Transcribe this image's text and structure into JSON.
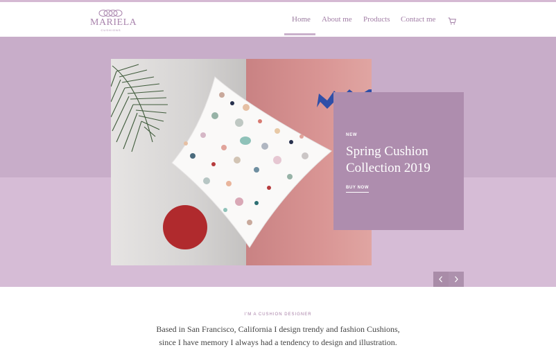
{
  "brand": {
    "name": "MARIELA",
    "tagline": "CUSHIONS",
    "accent": "#a984ad"
  },
  "nav": {
    "items": [
      {
        "label": "Home",
        "active": true
      },
      {
        "label": "About me",
        "active": false
      },
      {
        "label": "Products",
        "active": false
      },
      {
        "label": "Contact me",
        "active": false
      }
    ],
    "cart_icon": "cart-icon"
  },
  "hero": {
    "tag": "NEW",
    "title": "Spring Cushion Collection 2019",
    "cta": "BUY NOW",
    "prev_icon": "chevron-left-icon",
    "next_icon": "chevron-right-icon",
    "colors": {
      "band_top": "#c8adc9",
      "band_bottom": "#d6bcd6",
      "promo": "#ae8dae"
    }
  },
  "intro": {
    "eyebrow": "I'M A CUSHION DESIGNER",
    "line1": "Based in San Francisco, California I design trendy and fashion Cushions,",
    "line2": "since I have memory I always had a tendency to design and illustration."
  }
}
